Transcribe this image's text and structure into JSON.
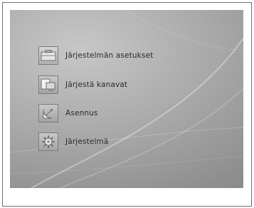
{
  "menu": {
    "items": [
      {
        "label": "Järjestelmän asetukset",
        "icon": "briefcase-icon",
        "selected": true
      },
      {
        "label": "Järjestä kanavat",
        "icon": "monitor-stack-icon",
        "selected": false
      },
      {
        "label": "Asennus",
        "icon": "satellite-dish-icon",
        "selected": false
      },
      {
        "label": "Järjestelmä",
        "icon": "gear-icon",
        "selected": false
      }
    ]
  }
}
